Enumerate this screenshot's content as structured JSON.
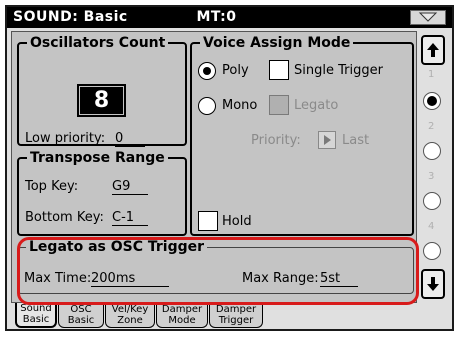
{
  "header": {
    "title": "SOUND: Basic",
    "mt_label": "MT:",
    "mt_value": "0"
  },
  "osc_count": {
    "legend": "Oscillators Count",
    "value": "8",
    "low_priority_label": "Low priority:",
    "low_priority_value": "0"
  },
  "voice_assign": {
    "legend": "Voice Assign Mode",
    "poly_label": "Poly",
    "single_trigger_label": "Single Trigger",
    "mono_label": "Mono",
    "legato_label": "Legato",
    "priority_label": "Priority:",
    "priority_value": "Last",
    "hold_label": "Hold",
    "selected": "Poly"
  },
  "transpose": {
    "legend": "Transpose Range",
    "top_key_label": "Top Key:",
    "top_key_value": "G9",
    "bottom_key_label": "Bottom Key:",
    "bottom_key_value": "C-1"
  },
  "legato_trigger": {
    "legend": "Legato as OSC Trigger",
    "max_time_label": "Max Time:",
    "max_time_value": "200ms",
    "max_range_label": "Max Range:",
    "max_range_value": "5st"
  },
  "sidebar": {
    "numbers": [
      "1",
      "2",
      "3",
      "4"
    ],
    "selected_index": 0
  },
  "tabs": [
    {
      "line1": "Sound",
      "line2": "Basic"
    },
    {
      "line1": "OSC",
      "line2": "Basic"
    },
    {
      "line1": "Vel/Key",
      "line2": "Zone"
    },
    {
      "line1": "Damper",
      "line2": "Mode"
    },
    {
      "line1": "Damper",
      "line2": "Trigger"
    }
  ],
  "colors": {
    "highlight": "#d81b1b",
    "titlebar": "#000000"
  }
}
